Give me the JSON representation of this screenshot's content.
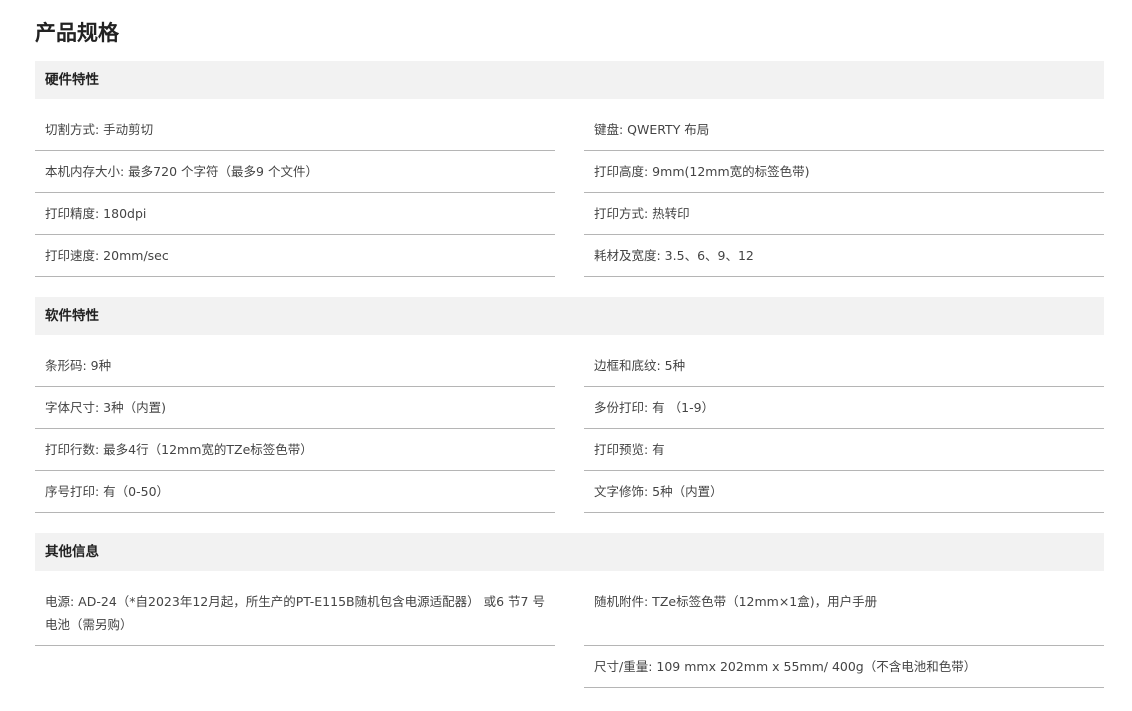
{
  "title": "产品规格",
  "sections": [
    {
      "heading": "硬件特性",
      "rows": [
        "切割方式: 手动剪切",
        "键盘: QWERTY 布局",
        "本机内存大小: 最多720 个字符（最多9 个文件）",
        "打印高度: 9mm(12mm宽的标签色带)",
        "打印精度: 180dpi",
        "打印方式: 热转印",
        "打印速度: 20mm/sec",
        "耗材及宽度: 3.5、6、9、12"
      ]
    },
    {
      "heading": "软件特性",
      "rows": [
        "条形码: 9种",
        "边框和底纹: 5种",
        "字体尺寸: 3种（内置)",
        "多份打印: 有 （1-9）",
        "打印行数: 最多4行（12mm宽的TZe标签色带）",
        "打印预览: 有",
        "序号打印: 有（0-50）",
        "文字修饰: 5种（内置）"
      ]
    },
    {
      "heading": "其他信息",
      "rows": [
        "电源: AD-24（*自2023年12月起，所生产的PT-E115B随机包含电源适配器） 或6 节7 号电池（需另购）",
        "随机附件: TZe标签色带（12mm×1盒)，用户手册",
        "",
        "尺寸/重量: 109 mmx 202mm x 55mm/ 400g（不含电池和色带）"
      ]
    }
  ]
}
